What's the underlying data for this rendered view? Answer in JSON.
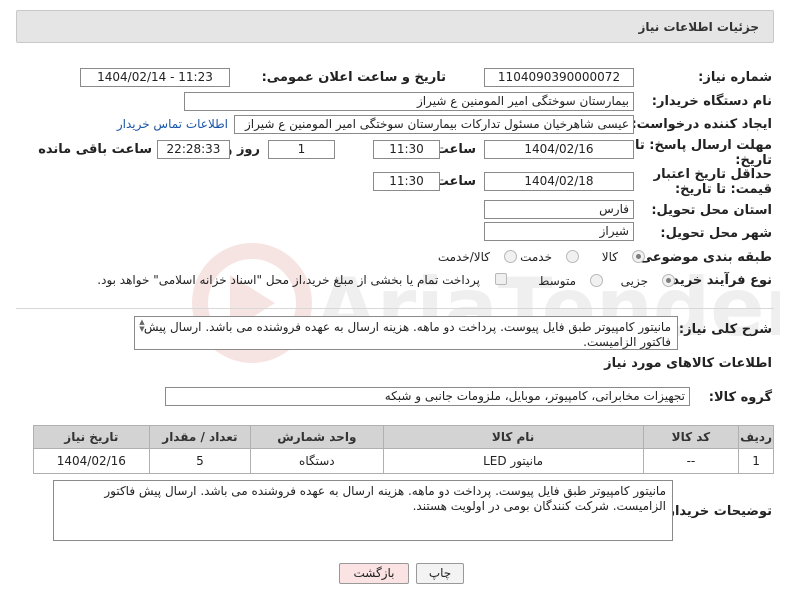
{
  "header": {
    "title": "جزئیات اطلاعات نیاز"
  },
  "form": {
    "need_number_label": "شماره نیاز:",
    "need_number": "1104090390000072",
    "announce_label": "تاریخ و ساعت اعلان عمومی:",
    "announce_value": "1404/02/14 - 11:23",
    "buyer_org_label": "نام دستگاه خریدار:",
    "buyer_org": "بیمارستان سوختگی امیر المومنین  ع  شیراز",
    "creator_label": "ایجاد کننده درخواست:",
    "creator": "عیسی  شاهرخیان مسئول تدارکات بیمارستان سوختگی امیر المومنین  ع  شیراز",
    "buyer_contact_link": "اطلاعات تماس خریدار",
    "reply_deadline_label": "مهلت ارسال پاسخ: تا تاریخ:",
    "reply_date": "1404/02/16",
    "time_label": "ساعت",
    "reply_time": "11:30",
    "days_count": "1",
    "days_label": "روز و",
    "remaining_time": "22:28:33",
    "remaining_label": "ساعت باقی مانده",
    "price_validity_label": "حداقل تاریخ اعتبار قیمت: تا تاریخ:",
    "price_date": "1404/02/18",
    "price_time": "11:30",
    "delivery_province_label": "استان محل تحویل:",
    "delivery_province": "فارس",
    "delivery_city_label": "شهر محل تحویل:",
    "delivery_city": "شیراز",
    "category_label": "طبقه بندی موضوعی:",
    "category_options": [
      "کالا",
      "خدمت",
      "کالا/خدمت"
    ],
    "process_label": "نوع فرآیند خرید :",
    "process_options": [
      "جزیی",
      "متوسط"
    ],
    "payment_note": "پرداخت تمام یا بخشی از مبلغ خرید،از محل \"اسناد خزانه اسلامی\" خواهد بود."
  },
  "description": {
    "label": "شرح کلی نیاز:",
    "text": "مانیتور کامپیوتر طبق فایل پیوست. پرداخت دو ماهه. هزینه ارسال به عهده فروشنده می باشد. ارسال پیش فاکتور الزامیست."
  },
  "goods_section": {
    "title": "اطلاعات کالاهای مورد نیاز",
    "group_label": "گروه کالا:",
    "group_value": "تجهیزات مخابراتی، کامپیوتر، موبایل، ملزومات جانبی و شبکه"
  },
  "table": {
    "headers": [
      "ردیف",
      "کد کالا",
      "نام کالا",
      "واحد شمارش",
      "تعداد / مقدار",
      "تاریخ نیاز"
    ],
    "rows": [
      {
        "row": "1",
        "code": "--",
        "name": "مانیتور LED",
        "unit": "دستگاه",
        "qty": "5",
        "date": "1404/02/16"
      }
    ]
  },
  "buyer_notes": {
    "label": "توضیحات خریدار:",
    "text": "مانیتور کامپیوتر طبق فایل پیوست. پرداخت دو ماهه. هزینه ارسال به عهده فروشنده می باشد. ارسال پیش فاکتور الزامیست. شرکت کنندگان بومی در اولویت هستند."
  },
  "buttons": {
    "print": "چاپ",
    "back": "بازگشت"
  },
  "watermark_text": "AriaTender.neT",
  "colors": {
    "link": "#1a55a8",
    "back_button_bg": "#fbe3e3",
    "watermark": "#c0392b"
  }
}
